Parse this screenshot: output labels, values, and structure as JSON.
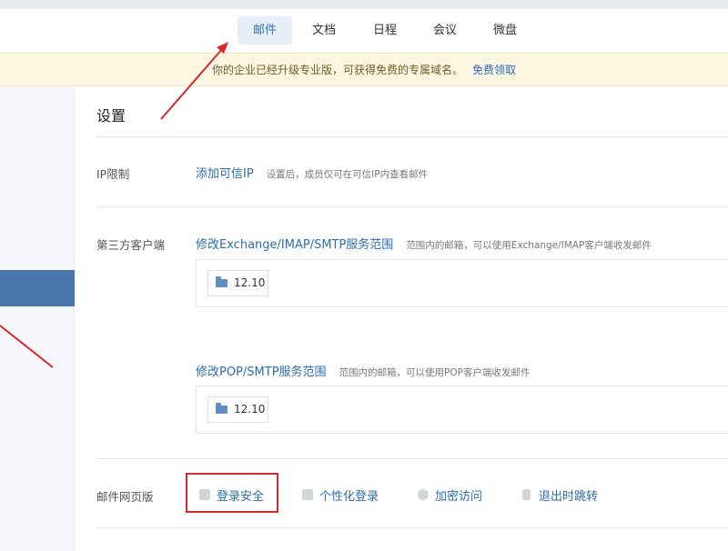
{
  "nav": {
    "tabs": [
      {
        "label": "邮件",
        "active": true
      },
      {
        "label": "文档",
        "active": false
      },
      {
        "label": "日程",
        "active": false
      },
      {
        "label": "会议",
        "active": false
      },
      {
        "label": "微盘",
        "active": false
      }
    ]
  },
  "notice": {
    "text": "你的企业已经升级专业版，可获得免费的专属域名。",
    "link": "免费领取"
  },
  "settings": {
    "title": "设置",
    "ip": {
      "label": "IP限制",
      "link": "添加可信IP",
      "desc": "设置后，成员仅可在可信IP内查看邮件"
    },
    "third_party": {
      "label": "第三方客户端",
      "exchange": {
        "link": "修改Exchange/IMAP/SMTP服务范围",
        "desc": "范围内的邮箱，可以使用Exchange/IMAP客户端收发邮件",
        "tag": "12.10"
      },
      "pop": {
        "link": "修改POP/SMTP服务范围",
        "desc": "范围内的邮箱，可以使用POP客户端收发邮件",
        "tag": "12.10"
      }
    },
    "web": {
      "label": "邮件网页版",
      "options": [
        "登录安全",
        "个性化登录",
        "加密访问",
        "退出时跳转"
      ]
    }
  },
  "colors": {
    "accent": "#2b6cb0",
    "highlight_box": "#d9262b",
    "sidebar_active": "#4a77ae",
    "notice_bg": "#fdf7e2"
  }
}
